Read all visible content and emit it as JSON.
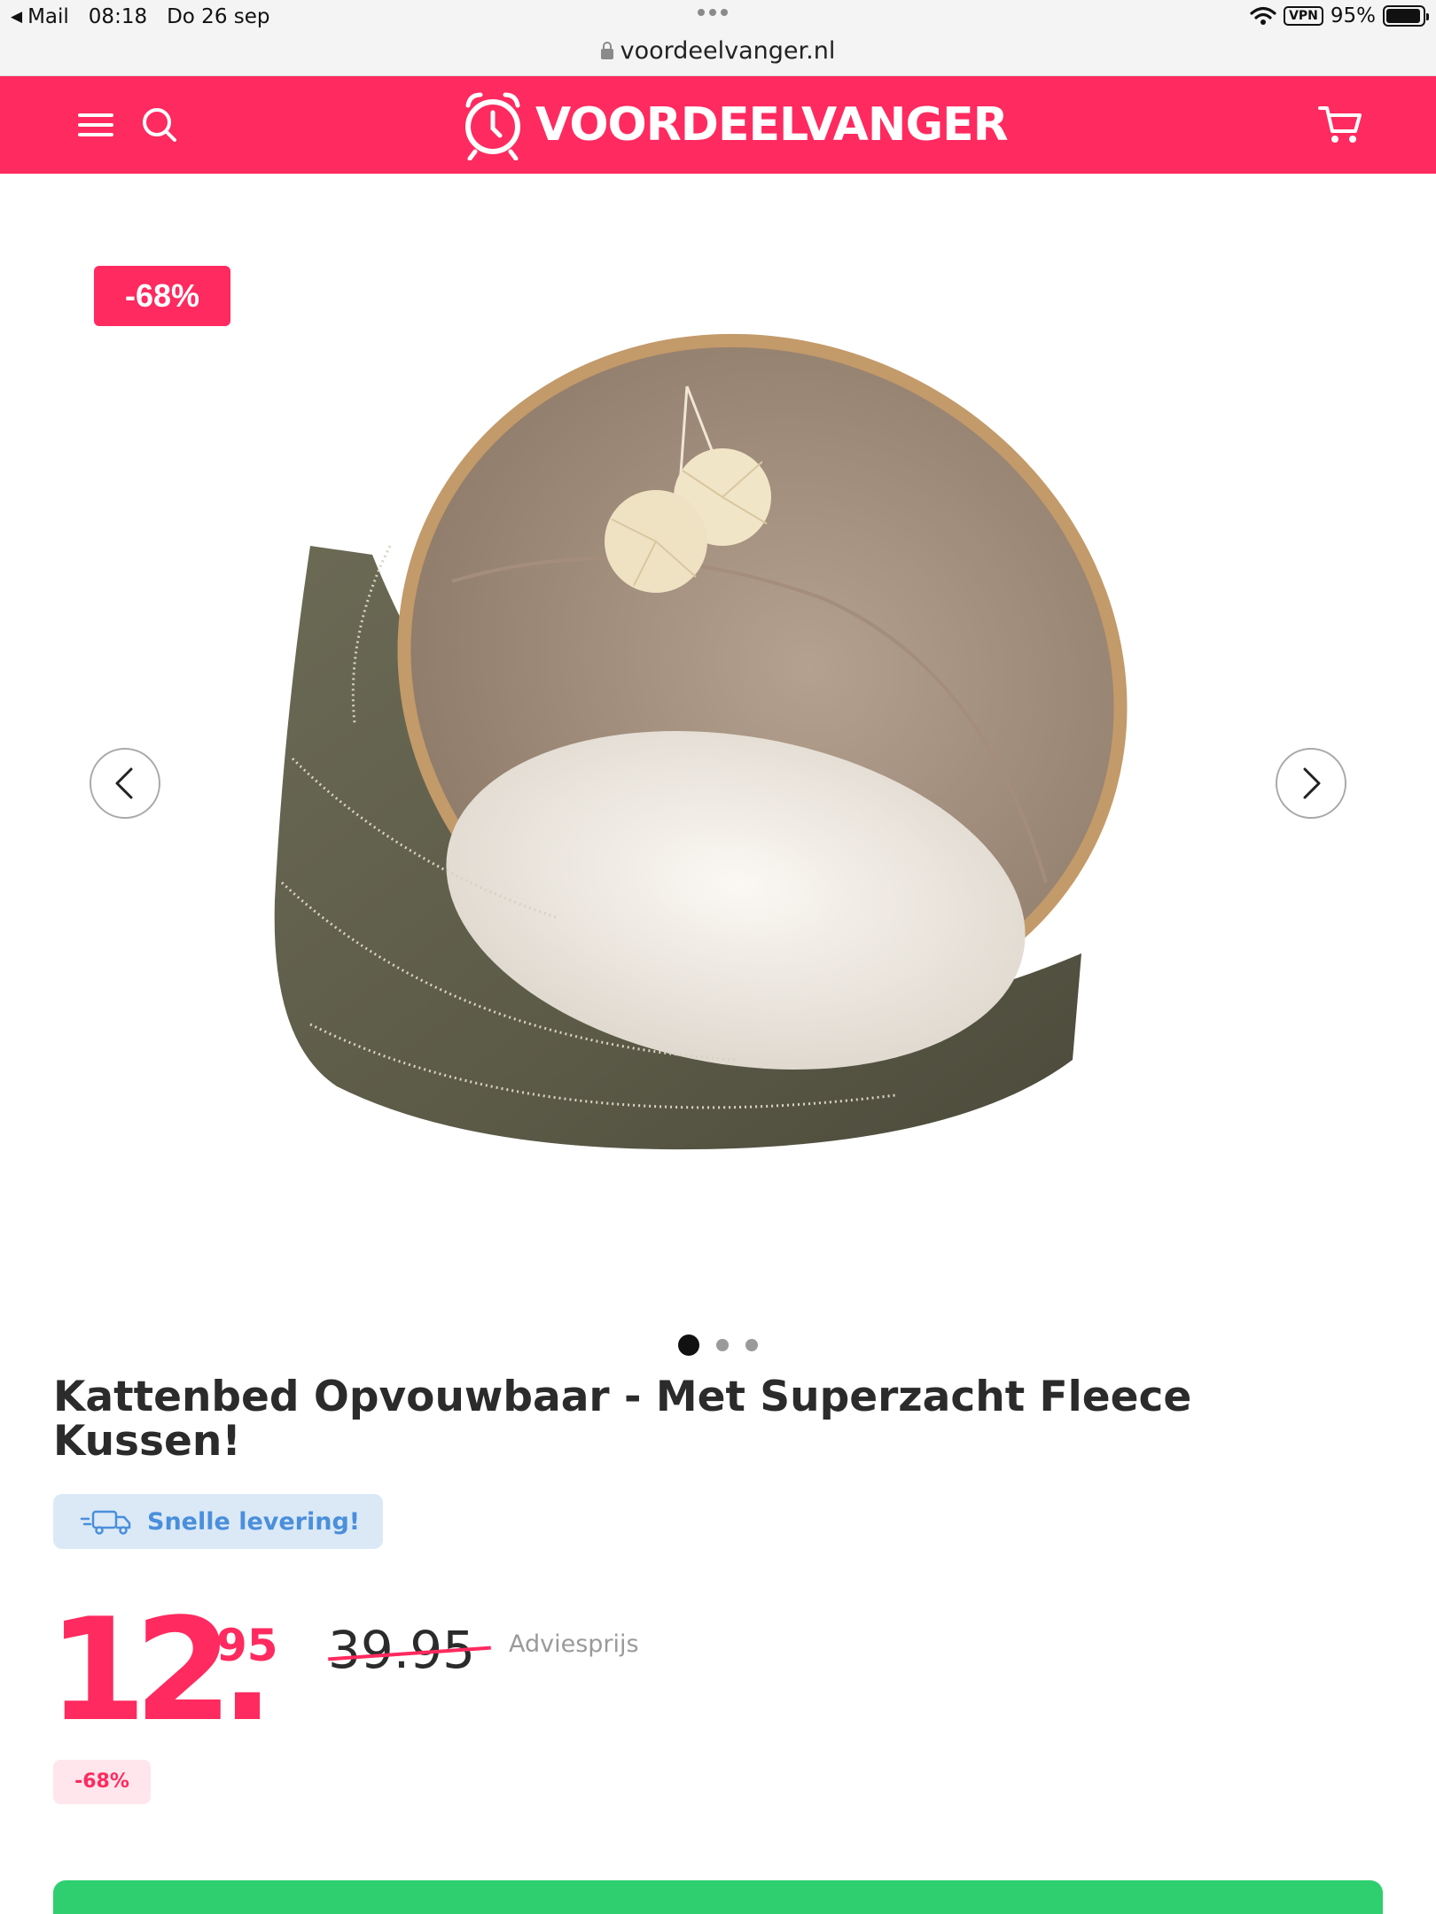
{
  "status_bar": {
    "back_app": "Mail",
    "time": "08:18",
    "date": "Do 26 sep",
    "vpn": "VPN",
    "battery": "95%",
    "battery_level": 0.95
  },
  "browser": {
    "url": "voordeelvanger.nl"
  },
  "header": {
    "brand": "VOORDEELVANGER",
    "brand_color": "#ff2a5f"
  },
  "gallery": {
    "discount_badge": "-68%",
    "slide_count": 3,
    "active_slide": 1
  },
  "product": {
    "title": "Kattenbed Opvouwbaar - Met Superzacht Fleece Kussen!",
    "delivery_label": "Snelle levering!",
    "price_whole": "12.",
    "price_cents": "95",
    "old_price": "39.95",
    "old_price_label": "Adviesprijs",
    "discount_chip": "-68%"
  },
  "colors": {
    "accent": "#ff2a5f",
    "delivery_text": "#4a8fdb",
    "delivery_bg": "#dbe9f7",
    "cta": "#2fcf6f"
  }
}
